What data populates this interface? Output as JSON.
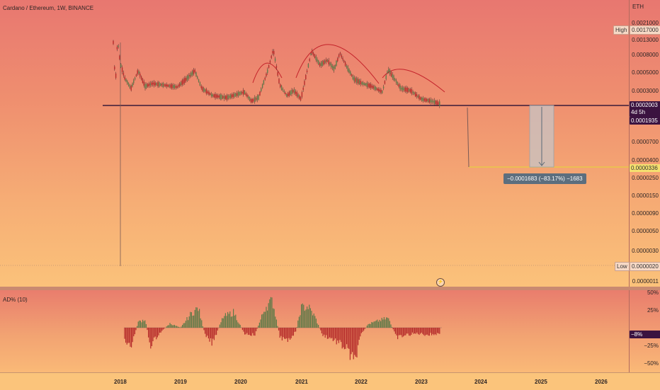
{
  "header": {
    "symbol_title": "Cardano / Ethereum, 1W, BINANCE",
    "currency": "ETH"
  },
  "price_axis": {
    "ticks": [
      "0.0021000",
      "0.0013000",
      "0.0008000",
      "0.0005000",
      "0.0003000",
      "0.0000700",
      "0.0000400",
      "0.0000250",
      "0.0000150",
      "0.0000090",
      "0.0000050",
      "0.0000030",
      "0.0000011"
    ]
  },
  "price_tags": {
    "high_label": "High",
    "high_value": "0.0017000",
    "current_value": "0.0002003",
    "countdown": "4d 5h",
    "level_value": "0.0001935",
    "target_value": "0.0000336",
    "low_label": "Low",
    "low_value": "0.0000020"
  },
  "measure": {
    "text": "−0.0001683 (−83.17%) −1683"
  },
  "indicator": {
    "title": "AD% (10)",
    "ticks": [
      "50%",
      "25%",
      "−25%",
      "−50%"
    ],
    "current_value": "−8%"
  },
  "time_axis": {
    "labels": [
      "2018",
      "2019",
      "2020",
      "2021",
      "2022",
      "2023",
      "2024",
      "2025",
      "2026"
    ]
  },
  "icons": {
    "flash": "lightning-icon"
  },
  "colors": {
    "up": "#5e7a48",
    "down": "#b52b2b",
    "level_line": "#3a1a3a",
    "target_line": "#e8c84a",
    "arc": "#c4222a"
  }
}
